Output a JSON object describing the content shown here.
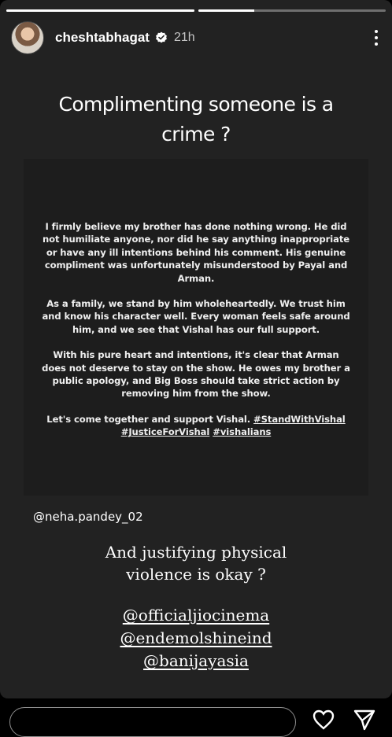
{
  "story": {
    "progress": [
      1,
      0.3
    ],
    "user": {
      "username": "cheshtabhagat",
      "time": "21h"
    },
    "headline": "Complimenting someone is a crime ?",
    "statement": {
      "paragraphs": [
        "I firmly believe my brother has done nothing wrong. He did not humiliate anyone, nor did he say anything inappropriate or have any ill intentions behind his comment. His genuine compliment was unfortunately misunderstood by Payal and Arman.",
        "As a family, we stand by him wholeheartedly. We trust him and know his character well. Every woman feels safe around him, and we see that Vishal has our full support.",
        "With his pure heart and intentions, it's clear that Arman does not deserve to stay on the show. He owes my brother a public apology, and Big Boss should take strict action by removing him from the show."
      ],
      "closing": "Let's come together and support Vishal.",
      "hashtags": [
        "#StandWithVishal",
        "#JusticeForVishal",
        "#vishalians"
      ]
    },
    "mention": "@neha.pandey_02",
    "question": "And justifying physical violence is okay ?",
    "tagged": [
      "@officialjiocinema",
      "@endemolshineind",
      "@banijayasia"
    ]
  },
  "icons": {
    "verified": "verified-badge-icon",
    "more": "more-options-icon",
    "like": "heart-icon",
    "share": "share-icon"
  },
  "colors": {
    "story_bg": "#222222",
    "statement_bg": "#1d1d1d",
    "text": "#ffffff",
    "secondary_text": "#c4c4c4"
  }
}
